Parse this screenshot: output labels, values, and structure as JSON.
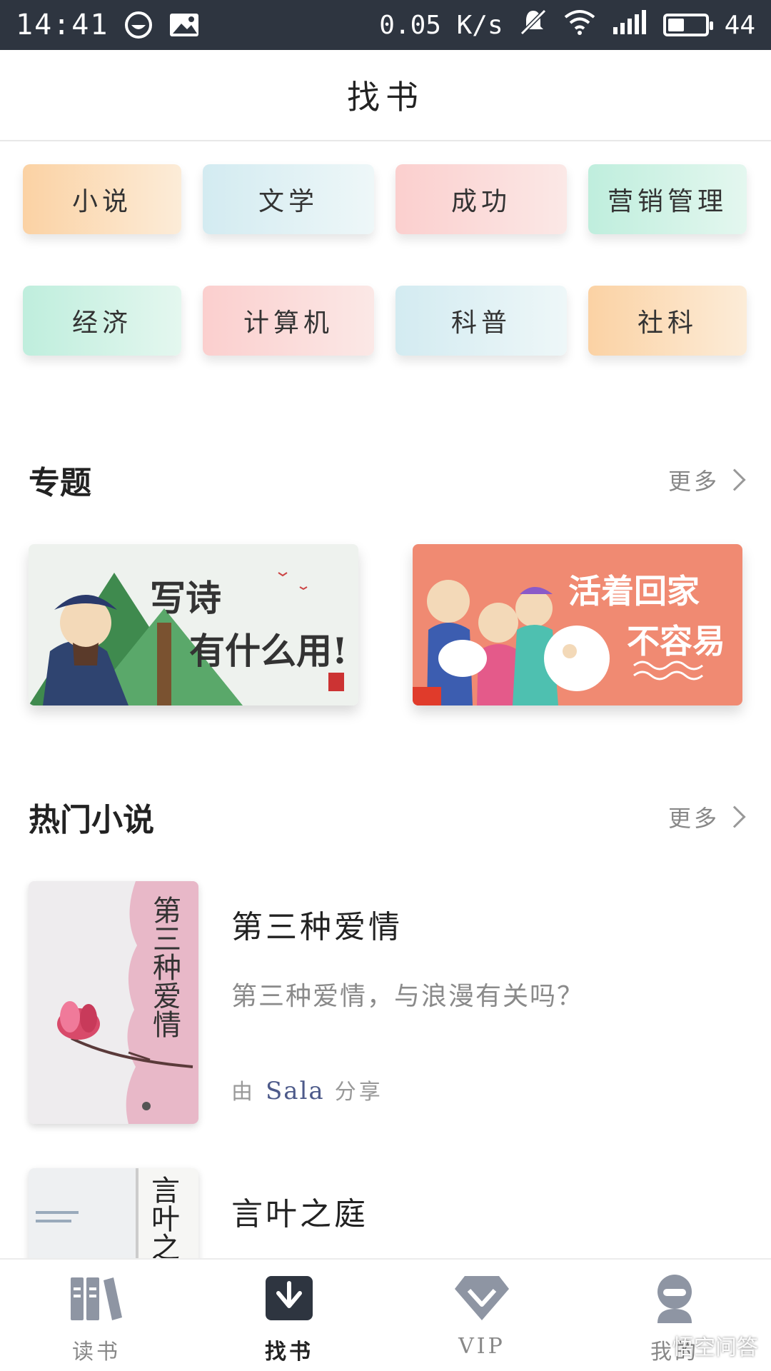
{
  "status_bar": {
    "time": "14:41",
    "speed": "0.05 K/s",
    "battery_level": "44",
    "battery_fraction": 0.44
  },
  "header": {
    "title": "找书"
  },
  "categories": [
    {
      "label": "小说",
      "color": "orange"
    },
    {
      "label": "文学",
      "color": "blue"
    },
    {
      "label": "成功",
      "color": "pink"
    },
    {
      "label": "营销管理",
      "color": "green"
    },
    {
      "label": "经济",
      "color": "green"
    },
    {
      "label": "计算机",
      "color": "pink"
    },
    {
      "label": "科普",
      "color": "blue"
    },
    {
      "label": "社科",
      "color": "orange"
    }
  ],
  "topics": {
    "title": "专题",
    "more": "更多",
    "items": [
      {
        "title_line1": "写诗",
        "title_line2": "有什么用!"
      },
      {
        "title_line1": "活着回家",
        "title_line2": "不容易"
      }
    ]
  },
  "hot_novels": {
    "title": "热门小说",
    "more": "更多",
    "books": [
      {
        "title": "第三种爱情",
        "description": "第三种爱情，与浪漫有关吗？",
        "share_prefix": "由",
        "user": "Sala",
        "share_suffix": "分享",
        "cover_text": "第三种爱情"
      },
      {
        "title": "言叶之庭",
        "cover_text": "言叶之庭"
      }
    ]
  },
  "bottom_nav": [
    {
      "label": "读书",
      "icon": "bookshelf-icon",
      "active": false
    },
    {
      "label": "找书",
      "icon": "find-book-icon",
      "active": true
    },
    {
      "label": "VIP",
      "icon": "diamond-icon",
      "active": false
    },
    {
      "label": "我的",
      "icon": "profile-icon",
      "active": false
    }
  ],
  "watermark": "悟空问答",
  "colors": {
    "status_bar": "#2e3540",
    "accent_user": "#4d5a8a",
    "banner2_bg": "#f08a72"
  }
}
